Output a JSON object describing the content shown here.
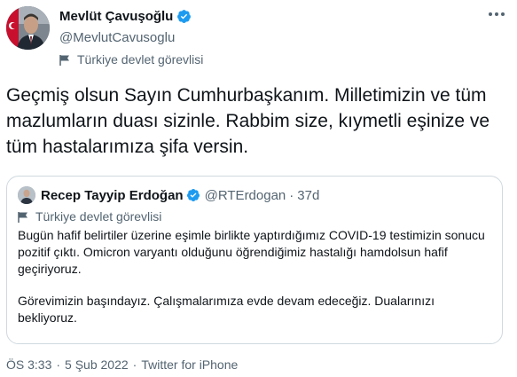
{
  "author": {
    "name": "Mevlüt Çavuşoğlu",
    "handle": "@MevlutCavusoglu",
    "label": "Türkiye devlet görevlisi"
  },
  "tweet": {
    "text": "Geçmiş olsun Sayın Cumhurbaşkanım. Milletimizin ve tüm mazlumların duası sizinle. Rabbim size, kıymetli eşinize ve tüm hastalarımıza şifa versin."
  },
  "quoted": {
    "name": "Recep Tayyip Erdoğan",
    "handle": "@RTErdogan",
    "separator": "·",
    "time": "37d",
    "label": "Türkiye devlet görevlisi",
    "paragraph1": "Bugün hafif belirtiler üzerine eşimle birlikte yaptırdığımız COVID-19 testimizin sonucu pozitif çıktı. Omicron varyantı olduğunu öğrendiğimiz hastalığı hamdolsun hafif geçiriyoruz.",
    "paragraph2": "Görevimizin başındayız. Çalışmalarımıza evde devam edeceğiz. Dualarınızı bekliyoruz."
  },
  "meta": {
    "time": "ÖS 3:33",
    "dot1": "·",
    "date": "5 Şub 2022",
    "dot2": "·",
    "source": "Twitter for iPhone"
  },
  "colors": {
    "verified": "#1d9bf0",
    "secondary_text": "#536471"
  }
}
